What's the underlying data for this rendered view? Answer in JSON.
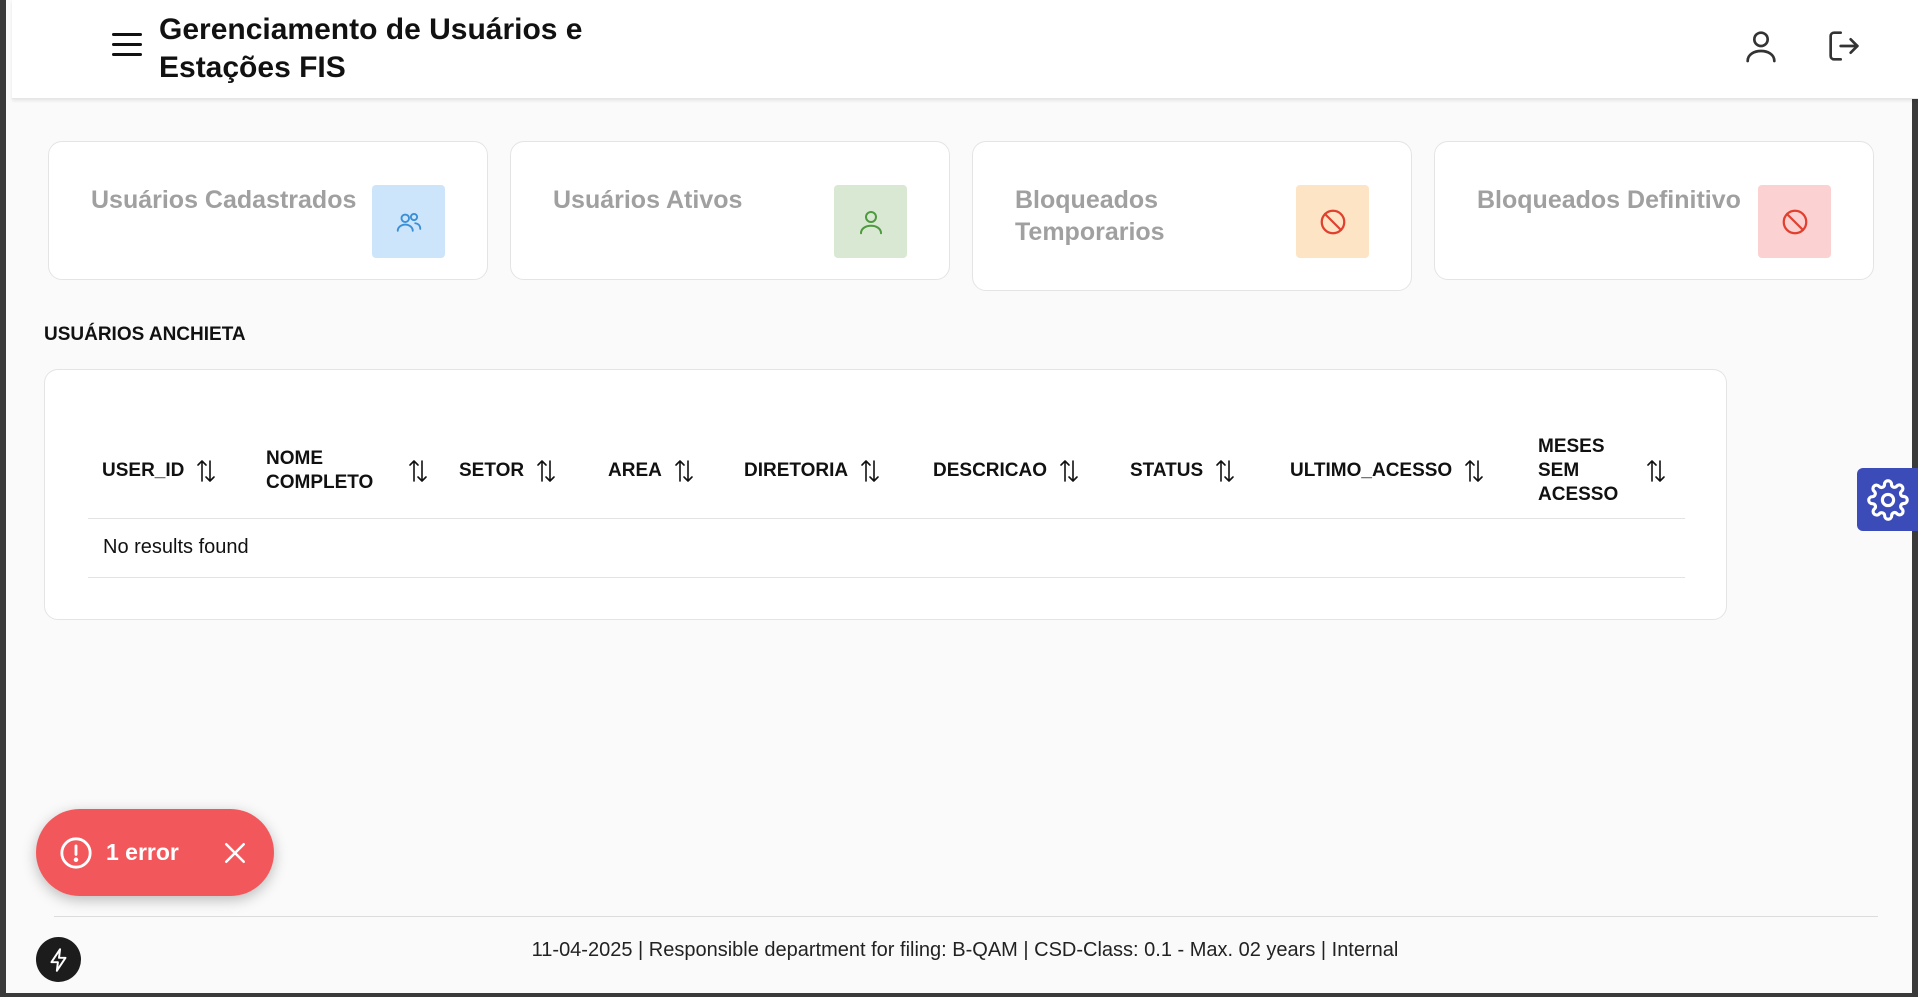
{
  "header": {
    "title": "Gerenciamento de Usuários e Estações FIS",
    "menu_icon": "hamburger-menu-icon",
    "user_icon": "user-icon",
    "logout_icon": "logout-icon"
  },
  "cards": [
    {
      "label": "Usuários Cadastrados",
      "icon": "users-icon",
      "bg": "#cce5fb",
      "fg": "#3b8fd6"
    },
    {
      "label": "Usuários Ativos",
      "icon": "user-icon",
      "bg": "#d9e8d2",
      "fg": "#4e9a3e"
    },
    {
      "label": "Bloqueados Temporarios",
      "icon": "block-icon",
      "bg": "#fde4c4",
      "fg": "#e0402f"
    },
    {
      "label": "Bloqueados Definitivo",
      "icon": "block-icon",
      "bg": "#fbd1d1",
      "fg": "#e0402f"
    }
  ],
  "table": {
    "title": "USUÁRIOS ANCHIETA",
    "columns": [
      "USER_ID",
      "NOME COMPLETO",
      "SETOR",
      "AREA",
      "DIRETORIA",
      "DESCRICAO",
      "STATUS",
      "ULTIMO_ACESSO",
      "MESES SEM ACESSO"
    ],
    "empty_message": "No results found"
  },
  "toast": {
    "text": "1 error",
    "color": "#f2585b"
  },
  "footer": {
    "text": "11-04-2025 | Responsible department for filing: B-QAM | CSD-Class: 0.1 - Max. 02 years | Internal"
  },
  "colors": {
    "accent": "#3b4bb8"
  }
}
